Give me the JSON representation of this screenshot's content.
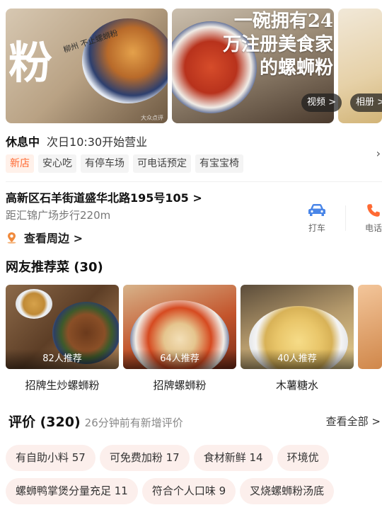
{
  "gallery": {
    "photo1_title": "粉",
    "photo1_subtitle": "柳州 不止螺蛳粉",
    "photo1_watermark": "大众点评",
    "photo2_slogan": "一碗拥有24万注册美食家的螺蛳粉",
    "video_button": "视频 >",
    "album_button": "相册 >"
  },
  "status": {
    "open_state": "休息中",
    "next_open": "次日10:30开始营业"
  },
  "tags": [
    "新店",
    "安心吃",
    "有停车场",
    "可电话预定",
    "有宝宝椅"
  ],
  "address": {
    "text": "高新区石羊街道盛华北路195号105 >",
    "distance": "距汇锦广场步行220m",
    "nearby": "查看周边 >"
  },
  "actions": {
    "taxi": "打车",
    "phone": "电话"
  },
  "dishes": {
    "title": "网友推荐菜 (30)",
    "items": [
      {
        "name": "招牌生炒螺蛳粉",
        "count": "82人推荐"
      },
      {
        "name": "招牌螺蛳粉",
        "count": "64人推荐"
      },
      {
        "name": "木薯糖水",
        "count": "40人推荐"
      }
    ]
  },
  "reviews": {
    "title": "评价 (320)",
    "subtitle": "26分钟前有新增评价",
    "view_all": "查看全部 >",
    "chips_row1": [
      "有自助小料 57",
      "可免费加粉 17",
      "食材新鲜 14",
      "环境优"
    ],
    "chips_row2": [
      "螺蛳鸭掌煲分量充足 11",
      "符合个人口味 9",
      "叉烧螺蛳粉汤底"
    ]
  },
  "colors": {
    "accent_orange": "#ff6a33",
    "taxi_blue": "#4a86e8",
    "chip_bg": "#fcefec"
  }
}
